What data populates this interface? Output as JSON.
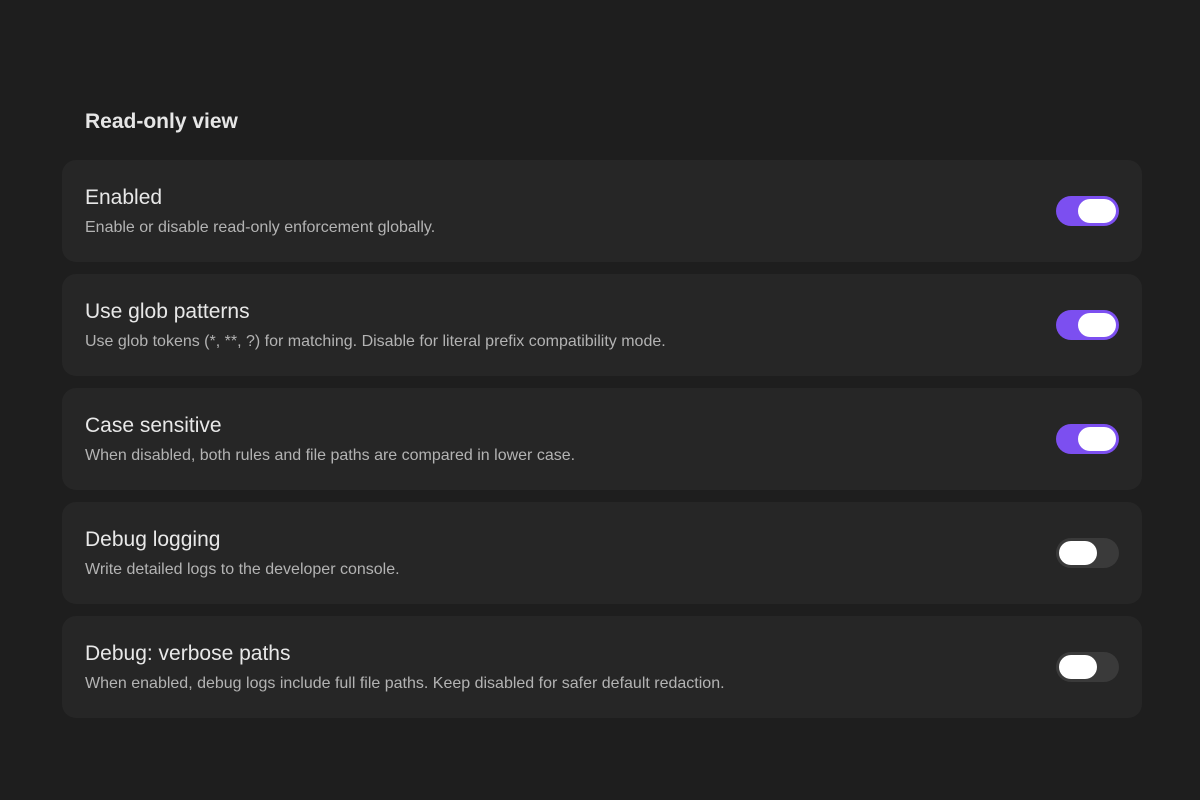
{
  "section": {
    "title": "Read-only view"
  },
  "colors": {
    "toggle_on": "#7c4ff0",
    "toggle_off": "#3a3a3a"
  },
  "settings": [
    {
      "name": "Enabled",
      "description": "Enable or disable read-only enforcement globally.",
      "enabled": true
    },
    {
      "name": "Use glob patterns",
      "description": "Use glob tokens (*, **, ?) for matching. Disable for literal prefix compatibility mode.",
      "enabled": true
    },
    {
      "name": "Case sensitive",
      "description": "When disabled, both rules and file paths are compared in lower case.",
      "enabled": true
    },
    {
      "name": "Debug logging",
      "description": "Write detailed logs to the developer console.",
      "enabled": false
    },
    {
      "name": "Debug: verbose paths",
      "description": "When enabled, debug logs include full file paths. Keep disabled for safer default redaction.",
      "enabled": false
    }
  ]
}
